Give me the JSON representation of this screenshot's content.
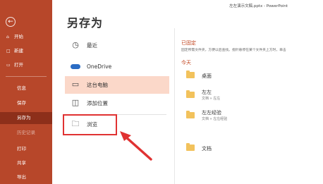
{
  "window": {
    "title": "左左演示文稿.pptx  -  PowerPoint"
  },
  "sidebar": {
    "back_icon": "arrow-left-icon",
    "items": [
      {
        "label": "开始",
        "icon": "home-icon"
      },
      {
        "label": "新建",
        "icon": "new-file-icon"
      },
      {
        "label": "打开",
        "icon": "folder-open-icon"
      },
      {
        "label": "信息"
      },
      {
        "label": "保存"
      },
      {
        "label": "另存为"
      },
      {
        "label": "历史记录"
      },
      {
        "label": "打印"
      },
      {
        "label": "共享"
      },
      {
        "label": "导出"
      }
    ]
  },
  "main": {
    "heading": "另存为",
    "locations": [
      {
        "label": "最近",
        "icon": "clock-icon"
      },
      {
        "label": "OneDrive",
        "icon": "cloud-icon"
      },
      {
        "label": "这台电脑",
        "icon": "computer-icon"
      },
      {
        "label": "添加位置",
        "icon": "add-location-icon"
      },
      {
        "label": "浏览",
        "icon": "folder-icon"
      }
    ]
  },
  "right": {
    "pinned_title": "已固定",
    "pinned_desc": "固定所需文件夹，方便以后查找。指针悬停在某个文件夹上方时，单击",
    "today_title": "今天",
    "folders": [
      {
        "name": "桌面",
        "path": ""
      },
      {
        "name": "左左",
        "path": "文档 » 左左"
      },
      {
        "name": "左左经验",
        "path": "文档 » 左左经验"
      },
      {
        "name": "文档",
        "path": ""
      }
    ]
  },
  "colors": {
    "sidebar": "#b7472a",
    "sidebar_active": "#8d2f1a",
    "selected": "#fbd8c9",
    "accent": "#c1431d",
    "annotation": "#e03232"
  }
}
